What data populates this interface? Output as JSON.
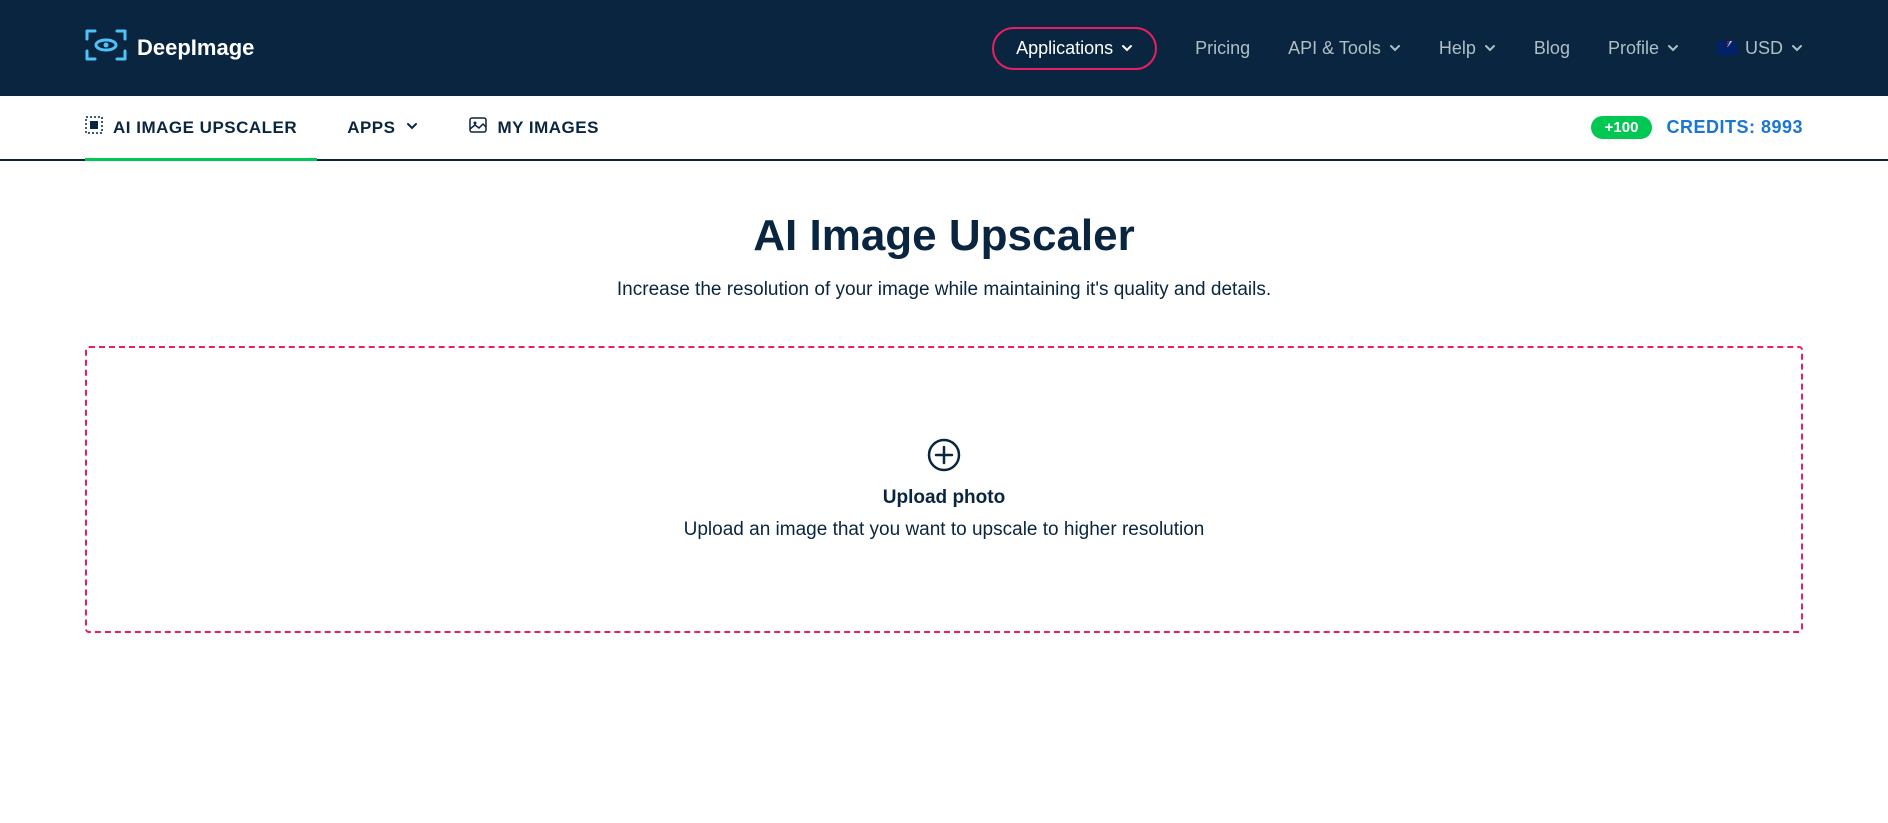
{
  "header": {
    "logo_text": "DeepImage",
    "nav": {
      "applications": "Applications",
      "pricing": "Pricing",
      "api_tools": "API & Tools",
      "help": "Help",
      "blog": "Blog",
      "profile": "Profile",
      "currency": "USD"
    }
  },
  "subnav": {
    "upscaler": "AI IMAGE UPSCALER",
    "apps": "APPS",
    "my_images": "MY IMAGES",
    "badge": "+100",
    "credits_label": "CREDITS: 8993"
  },
  "main": {
    "title": "AI Image Upscaler",
    "subtitle": "Increase the resolution of your image while maintaining it's quality and details.",
    "upload_title": "Upload photo",
    "upload_subtitle": "Upload an image that you want to upscale to higher resolution"
  }
}
